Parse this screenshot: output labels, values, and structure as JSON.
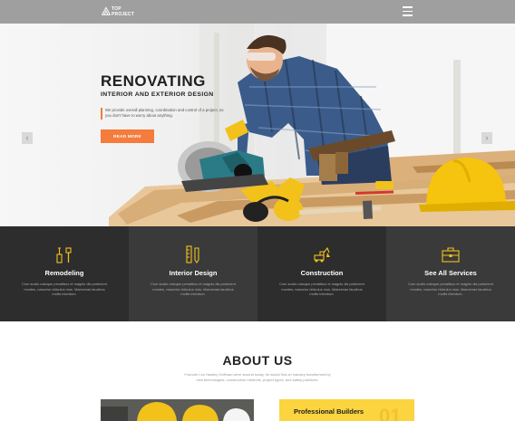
{
  "header": {
    "logo_line1": "TOP",
    "logo_line2": "PROJECT",
    "menu_icon": "hamburger-menu-icon"
  },
  "hero": {
    "title": "RENOVATING",
    "subtitle": "INTERIOR AND EXTERIOR DESIGN",
    "description": "We provide overall planning, coordination and control of a project, so you don't have to worry about anything.",
    "button_label": "READ MORE",
    "prev_arrow": "‹",
    "next_arrow": "›",
    "accent_color": "#f47c3c"
  },
  "services": [
    {
      "icon": "tools-icon",
      "name": "Remodeling",
      "text": "Cum sociis natoque penatibus et magnis dis parturient montes, nascetur ridiculus mus. Maecenas faucibus mollis interdum.",
      "bg": "#2d2d2d"
    },
    {
      "icon": "ruler-pencil-icon",
      "name": "Interior Design",
      "text": "Cum sociis natoque penatibus et magnis dis parturient montes, nascetur ridiculus mus. Maecenas faucibus mollis interdum.",
      "bg": "#3a3a3a"
    },
    {
      "icon": "excavator-icon",
      "name": "Construction",
      "text": "Cum sociis natoque penatibus et magnis dis parturient montes, nascetur ridiculus mus. Maecenas faucibus mollis interdum.",
      "bg": "#2d2d2d"
    },
    {
      "icon": "toolbox-icon",
      "name": "See All Services",
      "text": "Cum sociis natoque penatibus et magnis dis parturient montes, nascetur ridiculus mus. Maecenas faucibus mollis interdum.",
      "bg": "#3a3a3a"
    }
  ],
  "about": {
    "title": "ABOUT US",
    "text": "Founder Leo Hawley Hoffman were around today, he would find an industry transformed by new technologies, construction methods, project types, and safety practices.",
    "card_title": "Professional Builders",
    "card_number": "01",
    "card_color": "#fbd43f"
  }
}
